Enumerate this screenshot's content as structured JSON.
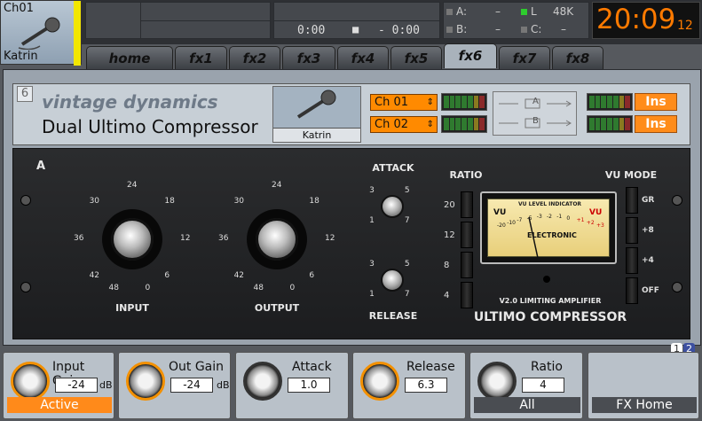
{
  "channel": {
    "id": "Ch01",
    "name": "Katrin",
    "icon": "microphone-icon"
  },
  "transport": {
    "time_pos": "0:00",
    "time_neg": "- 0:00",
    "stop": "■"
  },
  "status": {
    "a_label": "A:",
    "a_value": "–",
    "b_label": "B:",
    "b_value": "–",
    "l_label": "L",
    "rate": "48K",
    "c_label": "C:",
    "c_value": "–"
  },
  "clock": {
    "hm": "20:09",
    "sec": "12"
  },
  "tabs": [
    "home",
    "fx1",
    "fx2",
    "fx3",
    "fx4",
    "fx5",
    "fx6",
    "fx7",
    "fx8"
  ],
  "active_tab": "fx6",
  "header": {
    "slot": "6",
    "brand": "vintage dynamics",
    "title": "Dual Ultimo Compressor",
    "source_name": "Katrin",
    "ch1": "Ch 01",
    "ch2": "Ch 02",
    "route_a": "A",
    "route_b": "B",
    "ins1": "Ins",
    "ins2": "Ins"
  },
  "device": {
    "section": "A",
    "input_label": "INPUT",
    "output_label": "OUTPUT",
    "attack_label": "ATTACK",
    "release_label": "RELEASE",
    "ratio_label": "RATIO",
    "vu_mode_label": "VU MODE",
    "big_ticks": [
      "24",
      "30",
      "18",
      "36",
      "12",
      "42",
      "6",
      "48",
      "0"
    ],
    "small_ticks": [
      "3",
      "5",
      "1",
      "7"
    ],
    "ratios": [
      "20",
      "12",
      "8",
      "4"
    ],
    "vu_modes": [
      "GR",
      "+8",
      "+4",
      "OFF"
    ],
    "vu_title": "VU LEVEL INDICATOR",
    "vu_left": "VU",
    "vu_right": "VU",
    "vu_brand": "ELECTRONIC",
    "vu_scale": [
      "-20",
      "-10",
      "-7",
      "-5",
      "-3",
      "-2",
      "-1",
      "0",
      "+1",
      "+2",
      "+3"
    ],
    "model_sub": "V2.0 LIMITING AMPLIFIER",
    "model": "ULTIMO COMPRESSOR"
  },
  "bottom": {
    "page": [
      "1",
      "2"
    ],
    "input_gain": {
      "label": "Input Gain",
      "value": "-24",
      "unit": "dB",
      "button": "Active"
    },
    "out_gain": {
      "label": "Out Gain",
      "value": "-24",
      "unit": "dB"
    },
    "attack": {
      "label": "Attack",
      "value": "1.0"
    },
    "release": {
      "label": "Release",
      "value": "6.3"
    },
    "ratio": {
      "label": "Ratio",
      "value": "4",
      "button": "All"
    },
    "fx_home": {
      "button": "FX Home"
    }
  },
  "colors": {
    "accent": "#ff8a00",
    "clock": "#ff7a00",
    "active_tab": "#a9b2bb"
  }
}
